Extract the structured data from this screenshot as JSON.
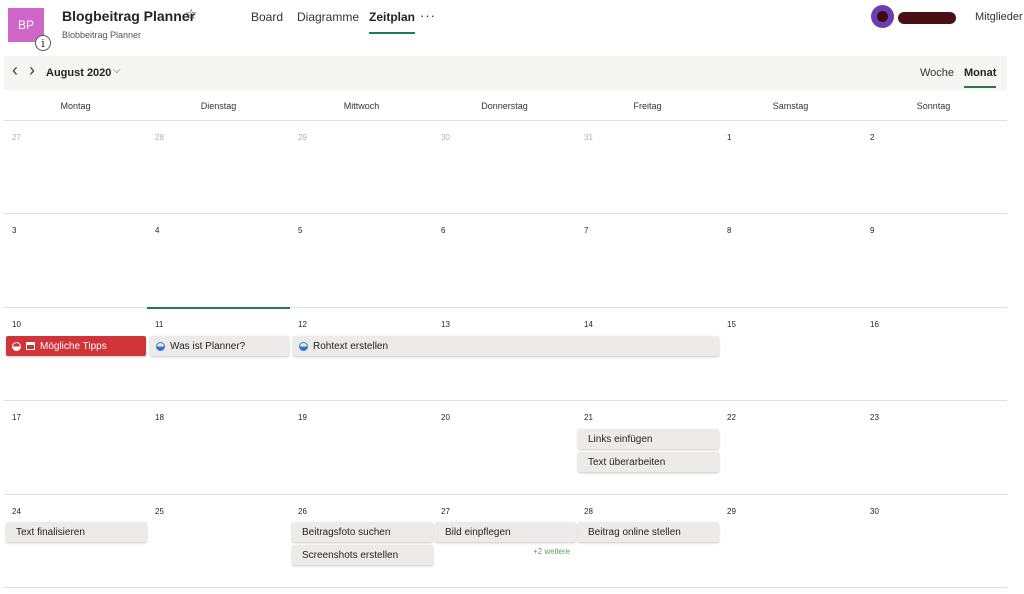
{
  "header": {
    "tile_initials": "BP",
    "info_glyph": "i",
    "title": "Blogbeitrag Planner",
    "star_glyph": "☆",
    "subtitle": "Blobbeitrag Planner",
    "tabs": [
      {
        "label": "Board"
      },
      {
        "label": "Diagramme"
      },
      {
        "label": "Zeitplan"
      }
    ],
    "more_glyph": "···",
    "members_label": "Mitglieder",
    "tile_color": "#d166c9",
    "accent_color": "#237b4b"
  },
  "toolbar": {
    "prev_glyph": "‹",
    "next_glyph": "›",
    "month": "August 2020",
    "month_dropdown_glyph": "⌵",
    "views": [
      {
        "label": "Woche"
      },
      {
        "label": "Monat"
      }
    ]
  },
  "calendar": {
    "weekdays": [
      "Montag",
      "Dienstag",
      "Mittwoch",
      "Donnerstag",
      "Freitag",
      "Samstag",
      "Sonntag"
    ],
    "weeks": [
      [
        "27",
        "28",
        "29",
        "30",
        "31",
        "1",
        "2"
      ],
      [
        "3",
        "4",
        "5",
        "6",
        "7",
        "8",
        "9"
      ],
      [
        "10",
        "11",
        "12",
        "13",
        "14",
        "15",
        "16"
      ],
      [
        "17",
        "18",
        "19",
        "20",
        "21",
        "22",
        "23"
      ],
      [
        "24",
        "25",
        "26",
        "27",
        "28",
        "29",
        "30"
      ]
    ],
    "tasks": {
      "t1": "Mögliche Tipps",
      "t2": "Was ist Planner?",
      "t3": "Rohtext erstellen",
      "t4": "Links einfügen",
      "t5": "Text überarbeiten",
      "t6": "Text finalisieren",
      "t7": "Beitragsfoto suchen",
      "t8": "Screenshots erstellen",
      "t9": "Bild einpflegen",
      "t10": "Beitrag online stellen"
    },
    "more_link": "+2 weitere",
    "overdue_color": "#d13438",
    "progress_color": "#2b7ad1"
  }
}
